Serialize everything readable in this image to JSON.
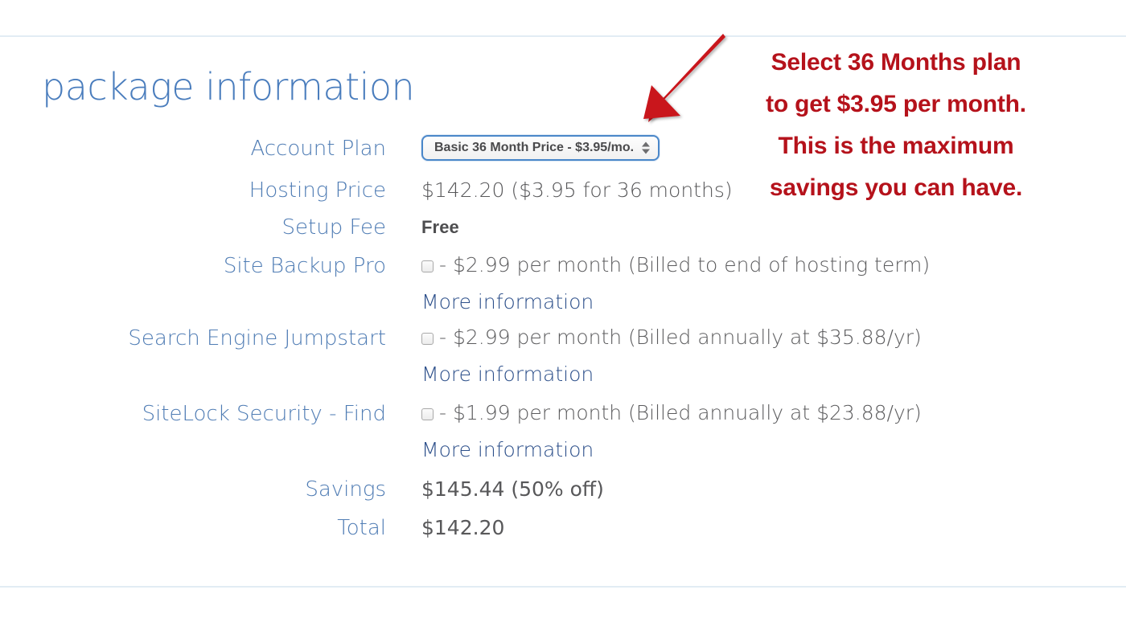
{
  "heading": "package information",
  "colors": {
    "heading_blue": "#4a7dbd",
    "label_blue": "#4f7cb4",
    "link_blue": "#2c4f8a",
    "value_grey": "#58585a",
    "annotation_red": "#b5121b",
    "rule": "#e2ecf4",
    "select_border": "#4a87c9"
  },
  "rows": {
    "account_plan": {
      "label": "Account Plan",
      "selected_option": "Basic 36 Month Price - $3.95/mo."
    },
    "hosting_price": {
      "label": "Hosting Price",
      "value": "$142.20  ($3.95 for 36 months)"
    },
    "setup_fee": {
      "label": "Setup Fee",
      "value": "Free"
    },
    "site_backup_pro": {
      "label": "Site Backup Pro",
      "option_text": "- $2.99 per month (Billed to end of hosting term)",
      "more_link": "More information"
    },
    "search_engine_jumpstart": {
      "label": "Search Engine Jumpstart",
      "option_text": "- $2.99 per month (Billed annually at $35.88/yr)",
      "more_link": "More information"
    },
    "sitelock_security": {
      "label": "SiteLock Security - Find",
      "option_text": "- $1.99 per month (Billed annually at $23.88/yr)",
      "more_link": "More information"
    },
    "savings": {
      "label": "Savings",
      "value": "$145.44 (50% off)"
    },
    "total": {
      "label": "Total",
      "value": "$142.20"
    }
  },
  "annotation": {
    "line1": "Select 36 Months plan",
    "line2": "to get $3.95 per month.",
    "line3": "This is the maximum",
    "line4": "savings you can have."
  }
}
